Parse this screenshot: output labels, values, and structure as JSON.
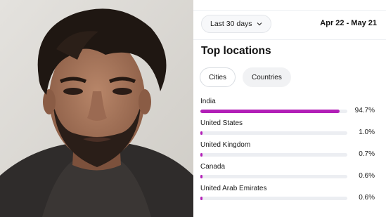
{
  "header": {
    "range_label": "Last 30 days",
    "date_range": "Apr 22 - May 21"
  },
  "section": {
    "title": "Top locations"
  },
  "tabs": [
    {
      "label": "Cities",
      "active": true
    },
    {
      "label": "Countries",
      "active": false
    }
  ],
  "locations": [
    {
      "name": "India",
      "percent": "94.7%",
      "share": 0.947
    },
    {
      "name": "United States",
      "percent": "1.0%",
      "share": 0.01
    },
    {
      "name": "United Kingdom",
      "percent": "0.7%",
      "share": 0.007
    },
    {
      "name": "Canada",
      "percent": "0.6%",
      "share": 0.006
    },
    {
      "name": "United Arab Emirates",
      "percent": "0.6%",
      "share": 0.006
    }
  ],
  "colors": {
    "bar_fill": "#b21fb7",
    "bar_track": "#eceef2"
  },
  "icons": {
    "range_dropdown": "chevron-down-icon"
  }
}
